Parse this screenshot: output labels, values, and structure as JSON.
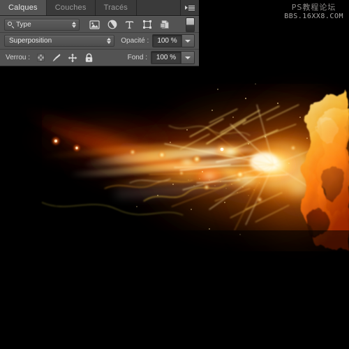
{
  "window": {
    "title": "Photoshop Layers Panel over fire artwork",
    "canvas_bg": "#000000"
  },
  "watermark": {
    "line1": "PS教程论坛",
    "line2": "BBS.16XX8.COM"
  },
  "panel": {
    "tabs": [
      {
        "label": "Calques",
        "active": true
      },
      {
        "label": "Couches",
        "active": false
      },
      {
        "label": "Tracés",
        "active": false
      }
    ],
    "menu_icon": "panel-menu-icon",
    "filter_row": {
      "search_icon": "magnifier-icon",
      "filter_type_label": "Type",
      "spinner_icon": "up-down-arrows-icon",
      "icons": [
        {
          "name": "pixel-layers-filter-icon",
          "title": "Image"
        },
        {
          "name": "adjustment-layers-filter-icon",
          "title": "Réglage"
        },
        {
          "name": "type-layers-filter-icon",
          "title": "Texte"
        },
        {
          "name": "shape-layers-filter-icon",
          "title": "Forme"
        },
        {
          "name": "smart-object-filter-icon",
          "title": "Objet dynamique"
        }
      ],
      "toggle_name": "filter-enable-toggle"
    },
    "blend_row": {
      "blend_mode": "Superposition",
      "opacity_label": "Opacité :",
      "opacity_value": "100 %"
    },
    "lock_row": {
      "lock_label": "Verrou :",
      "locks": [
        {
          "name": "lock-transparency-icon",
          "title": "Verrouiller les pixels transparents"
        },
        {
          "name": "lock-pixels-brush-icon",
          "title": "Verrouiller les pixels de l'image"
        },
        {
          "name": "lock-position-move-icon",
          "title": "Verrouiller la position"
        },
        {
          "name": "lock-all-padlock-icon",
          "title": "Tout verrouiller"
        }
      ],
      "fill_label": "Fond :",
      "fill_value": "100 %"
    }
  },
  "artwork": {
    "description": "Explosion de lumière et de flammes orange sur fond noir",
    "colors": {
      "background": "#000000",
      "deep_red": "#8a1c05",
      "orange": "#ff7a10",
      "amber": "#ffa820",
      "gold": "#ffd34d",
      "core_white": "#fffbe8"
    }
  }
}
